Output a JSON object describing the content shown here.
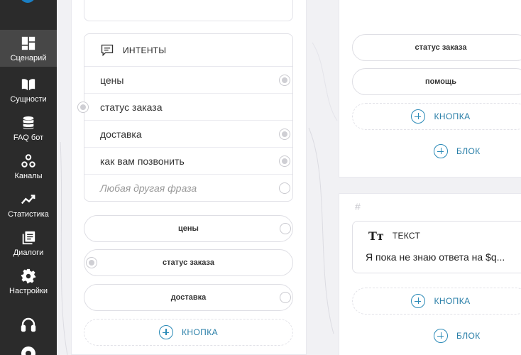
{
  "sidebar": {
    "items": [
      {
        "label": "Сценарий",
        "icon": "dashboard-icon",
        "active": true
      },
      {
        "label": "Сущности",
        "icon": "book-icon"
      },
      {
        "label": "FAQ бот",
        "icon": "database-icon"
      },
      {
        "label": "Каналы",
        "icon": "channels-icon"
      },
      {
        "label": "Статистика",
        "icon": "chart-line-icon"
      },
      {
        "label": "Диалоги",
        "icon": "dialogs-icon"
      },
      {
        "label": "Настройки",
        "icon": "gear-icon"
      }
    ],
    "bottom_icons": [
      "headset-icon",
      "lifebuoy-icon"
    ]
  },
  "left_block": {
    "intents": {
      "title": "ИНТЕНТЫ",
      "rows": [
        "цены",
        "статус заказа",
        "доставка",
        "как вам позвонить"
      ],
      "fallback": "Любая другая фраза"
    },
    "buttons": [
      "цены",
      "статус заказа",
      "доставка"
    ],
    "add_button": "КНОПКА"
  },
  "right_top_block": {
    "buttons": [
      "статус заказа",
      "помощь"
    ],
    "add_button": "КНОПКА",
    "add_block": "БЛОК"
  },
  "right_bottom_block": {
    "hash": "#",
    "text_card": {
      "title": "ТЕКСТ",
      "body": "Я пока не знаю ответа на $q..."
    },
    "add_button": "КНОПКА",
    "add_block": "БЛОК"
  },
  "colors": {
    "sidebar": "#2b2b2b",
    "sidebar_active": "#474747",
    "accent": "#2a8ab7"
  }
}
